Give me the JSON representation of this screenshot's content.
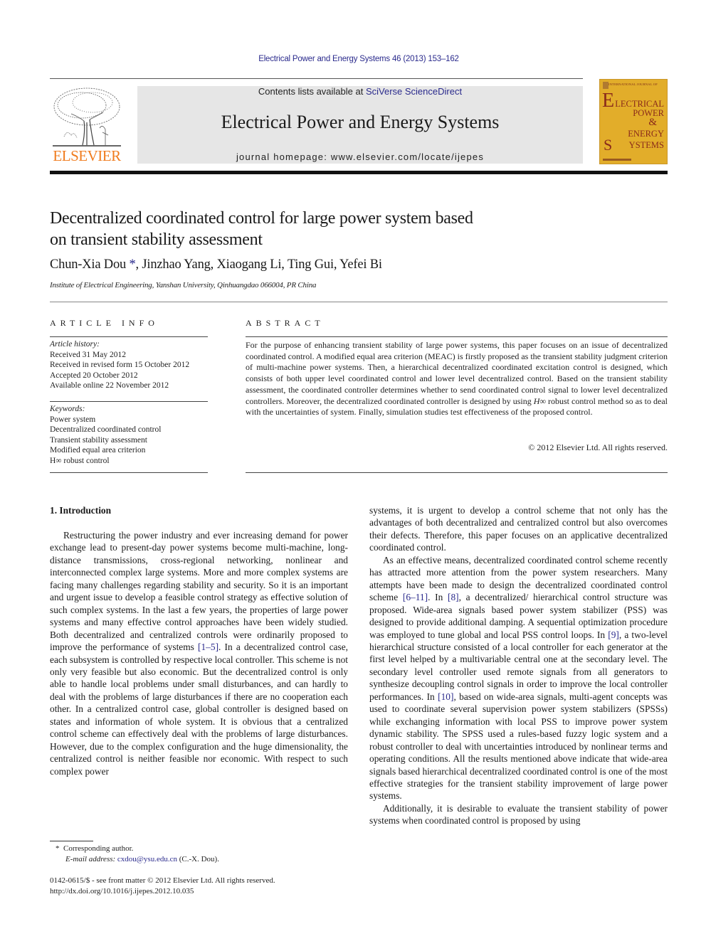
{
  "header": {
    "journal_reference": "Electrical Power and Energy Systems 46 (2013) 153–162",
    "contents_prefix": "Contents lists available at ",
    "contents_link": "SciVerse ScienceDirect",
    "journal_title": "Electrical Power and Energy Systems",
    "homepage": "journal homepage: www.elsevier.com/locate/ijepes",
    "publisher_logo_text": "ELSEVIER",
    "cover": {
      "top_line": "INTERNATIONAL JOURNAL OF",
      "big_e": "E",
      "line1": "LECTRICAL",
      "line2": "POWER",
      "line3": "&",
      "line4": "ENERGY",
      "big_s": "S",
      "line5": "YSTEMS"
    },
    "colors": {
      "link": "#2a2a8c",
      "elsevier_orange": "#f07c1e",
      "cover_gold": "#e2ad2a",
      "banner_gray": "#e6e6e6"
    }
  },
  "article": {
    "title_line1": "Decentralized coordinated control for large power system based",
    "title_line2": "on transient stability assessment",
    "authors": {
      "first": "Chun-Xia Dou",
      "first_marker": "*",
      "rest": ", Jinzhao Yang, Xiaogang Li, Ting Gui, Yefei Bi"
    },
    "affiliation": "Institute of Electrical Engineering, Yanshan University, Qinhuangdao 066004, PR China"
  },
  "article_info": {
    "heading": "ARTICLE INFO",
    "history_label": "Article history:",
    "history": [
      "Received 31 May 2012",
      "Received in revised form 15 October 2012",
      "Accepted 20 October 2012",
      "Available online 22 November 2012"
    ],
    "keywords_label": "Keywords:",
    "keywords": [
      "Power system",
      "Decentralized coordinated control",
      "Transient stability assessment",
      "Modified equal area criterion",
      "H∞ robust control"
    ]
  },
  "abstract": {
    "heading": "ABSTRACT",
    "text_part1": "For the purpose of enhancing transient stability of large power systems, this paper focuses on an issue of decentralized coordinated control. A modified equal area criterion (MEAC) is firstly proposed as the transient stability judgment criterion of multi-machine power systems. Then, a hierarchical decentralized coordinated excitation control is designed, which consists of both upper level coordinated control and lower level decentralized control. Based on the transient stability assessment, the coordinated controller determines whether to send coordinated control signal to lower level decentralized controllers. Moreover, the decentralized coordinated controller is designed by using ",
    "h_symbol": "H∞",
    "text_part2": " robust control method so as to deal with the uncertainties of system. Finally, simulation studies test effectiveness of the proposed control.",
    "copyright": "© 2012 Elsevier Ltd. All rights reserved."
  },
  "body": {
    "section_title": "1. Introduction",
    "left_p1_a": "Restructuring the power industry and ever increasing demand for power exchange lead to present-day power systems become multi-machine, long-distance transmissions, cross-regional networking, nonlinear and interconnected complex large systems. More and more complex systems are facing many challenges regarding stability and security. So it is an important and urgent issue to develop a feasible control strategy as effective solution of such complex systems. In the last a few years, the properties of large power systems and many effective control approaches have been widely studied. Both decentralized and centralized controls were ordinarily proposed to improve the performance of systems ",
    "ref_1_5": "[1–5]",
    "left_p1_b": ". In a decentralized control case, each subsystem is controlled by respective local controller. This scheme is not only very feasible but also economic. But the decentralized control is only able to handle local problems under small disturbances, and can hardly to deal with the problems of large disturbances if there are no cooperation each other. In a centralized control case, global controller is designed based on states and information of whole system. It is obvious that a centralized control scheme can effectively deal with the problems of large disturbances. However, due to the complex configuration and the huge dimensionality, the centralized control is neither feasible nor economic. With respect to such complex power",
    "right_p1": "systems, it is urgent to develop a control scheme that not only has the advantages of both decentralized and centralized control but also overcomes their defects. Therefore, this paper focuses on an applicative decentralized coordinated control.",
    "right_p2_a": "As an effective means, decentralized coordinated control scheme recently has attracted more attention from the power system researchers. Many attempts have been made to design the decentralized coordinated control scheme ",
    "ref_6_11": "[6–11]",
    "right_p2_b": ". In ",
    "ref_8": "[8]",
    "right_p2_c": ", a decentralized/ hierarchical control structure was proposed. Wide-area signals based power system stabilizer (PSS) was designed to provide additional damping. A sequential optimization procedure was employed to tune global and local PSS control loops. In ",
    "ref_9": "[9]",
    "right_p2_d": ", a two-level hierarchical structure consisted of a local controller for each generator at the first level helped by a multivariable central one at the secondary level. The secondary level controller used remote signals from all generators to synthesize decoupling control signals in order to improve the local controller performances. In ",
    "ref_10": "[10]",
    "right_p2_e": ", based on wide-area signals, multi-agent concepts was used to coordinate several supervision power system stabilizers (SPSSs) while exchanging information with local PSS to improve power system dynamic stability. The SPSS used a rules-based fuzzy logic system and a robust controller to deal with uncertainties introduced by nonlinear terms and operating conditions. All the results mentioned above indicate that wide-area signals based hierarchical decentralized coordinated control is one of the most effective strategies for the transient stability improvement of large power systems.",
    "right_p3": "Additionally, it is desirable to evaluate the transient stability of power systems when coordinated control is proposed by using"
  },
  "footnotes": {
    "corresponding_marker": "*",
    "corresponding_text": "Corresponding author.",
    "email_label": "E-mail address: ",
    "email": "cxdou@ysu.edu.cn",
    "email_suffix": " (C.-X. Dou).",
    "issn_line": "0142-0615/$ - see front matter © 2012 Elsevier Ltd. All rights reserved.",
    "doi": "http://dx.doi.org/10.1016/j.ijepes.2012.10.035"
  }
}
